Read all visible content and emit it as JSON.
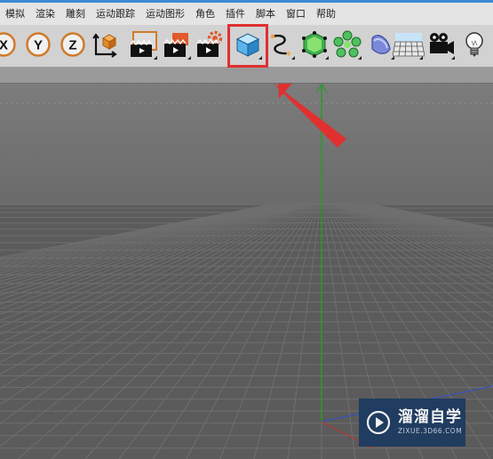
{
  "menu": {
    "items": [
      "模拟",
      "渲染",
      "雕刻",
      "运动跟踪",
      "运动图形",
      "角色",
      "插件",
      "脚本",
      "窗口",
      "帮助"
    ]
  },
  "toolbar": {
    "axis_buttons": [
      "X",
      "Y",
      "Z"
    ],
    "icons": [
      "coordinate-system-icon",
      "render-view-icon",
      "render-picture-viewer-icon",
      "render-settings-icon",
      "cube-object-icon",
      "spline-pen-icon",
      "subdivision-surface-icon",
      "cloner-icon",
      "deformer-icon",
      "floor-icon",
      "camera-icon",
      "light-icon"
    ],
    "highlighted_tool": "cube-object-icon"
  },
  "watermark": {
    "title": "溜溜自学",
    "url": "ZIXUE.3D66.COM"
  },
  "colors": {
    "highlight_box": "#e03030",
    "annotation_arrow": "#e03030",
    "y_axis": "#2a9a2a",
    "x_axis": "#c03030",
    "z_axis": "#3050d0",
    "accent": "#3f8ad6"
  }
}
